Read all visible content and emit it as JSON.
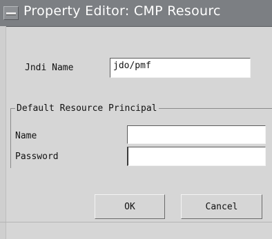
{
  "window": {
    "title": "Property Editor: CMP Resourc"
  },
  "form": {
    "jndi_label": "Jndi Name",
    "jndi_value": "jdo/pmf"
  },
  "principal": {
    "group_title": "Default Resource Principal",
    "name_label": "Name",
    "name_value": "",
    "password_label": "Password",
    "password_value": ""
  },
  "buttons": {
    "ok_label": "OK",
    "cancel_label": "Cancel"
  }
}
